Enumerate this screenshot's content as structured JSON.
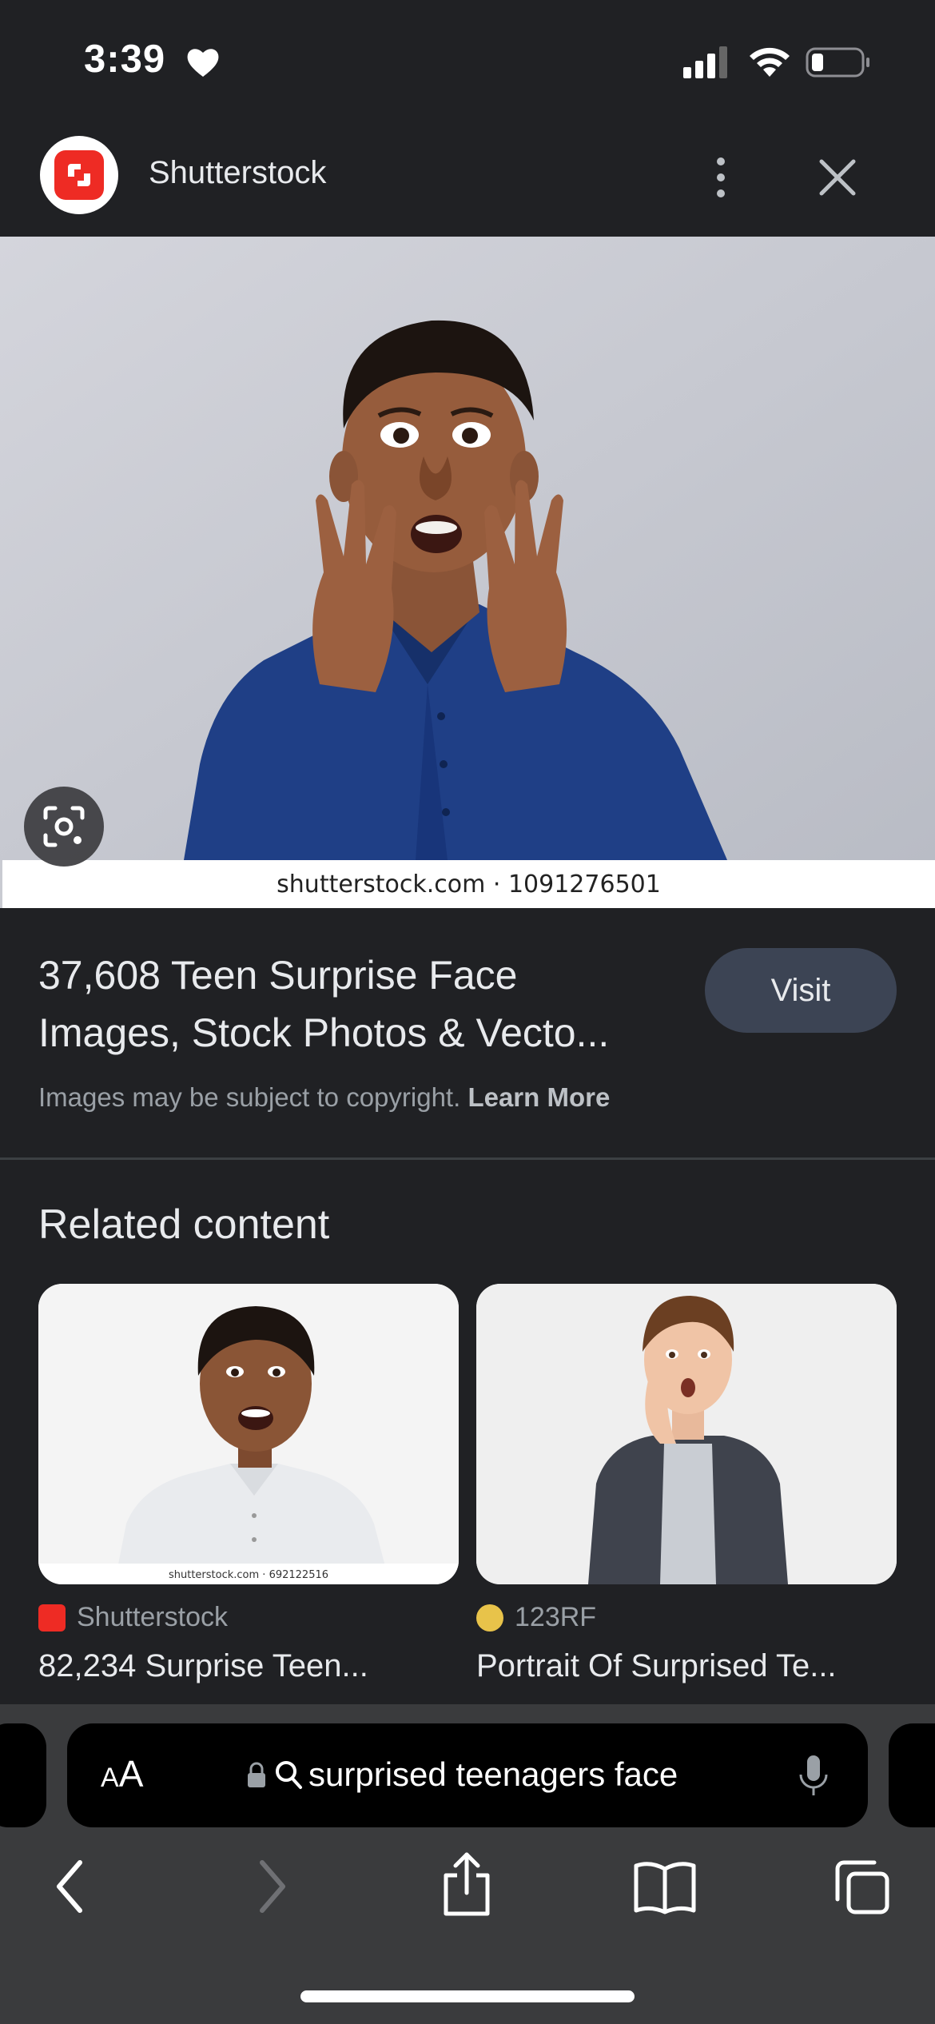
{
  "status_bar": {
    "time": "3:39",
    "icons": [
      "heart-icon",
      "cellular-signal-icon",
      "wifi-icon",
      "battery-icon"
    ]
  },
  "header": {
    "site_name": "Shutterstock",
    "logo_icon": "shutterstock-logo-icon",
    "more_icon": "more-vertical-icon",
    "close_icon": "close-icon"
  },
  "main_image": {
    "watermark": "shutterstock.com · 1091276501",
    "lens_icon": "lens-search-icon"
  },
  "result": {
    "title_line_1": "37,608 Teen Surprise Face",
    "title_line_2": "Images, Stock Photos & Vecto...",
    "visit_label": "Visit",
    "copyright_text": "Images may be subject to copyright.",
    "learn_more_label": "Learn More"
  },
  "related": {
    "heading": "Related content",
    "cards": [
      {
        "source": "Shutterstock",
        "caption": "82,234 Surprise Teen...",
        "thumb_watermark": "shutterstock.com · 692122516",
        "source_icon": "shutterstock-favicon"
      },
      {
        "source": "123RF",
        "caption": "Portrait Of Surprised Te...",
        "source_icon": "123rf-favicon"
      }
    ]
  },
  "browser": {
    "aa_label_big": "A",
    "aa_label_small": "A",
    "url_text": "surprised teenagers face",
    "toolbar_icons": [
      "back-icon",
      "forward-icon",
      "share-icon",
      "bookmarks-icon",
      "tabs-icon"
    ]
  },
  "colors": {
    "background": "#202124",
    "visit_button": "#3c4454",
    "shutterstock_red": "#ee2b24",
    "shirt_blue": "#1f3f86",
    "chrome_bar": "#3a3b3d"
  }
}
